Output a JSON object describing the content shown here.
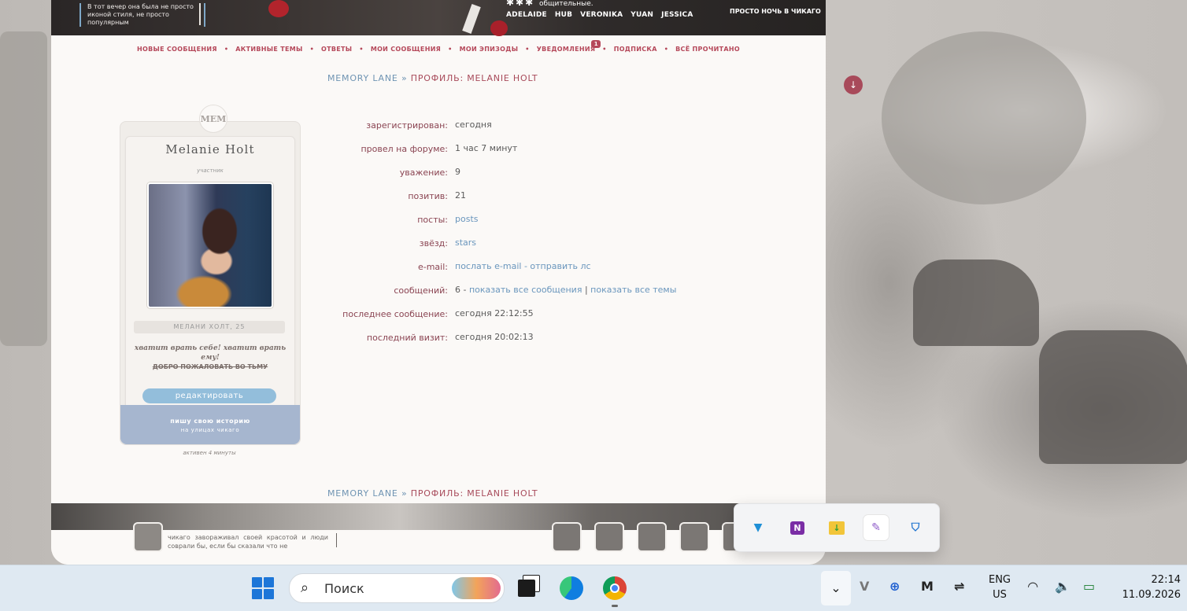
{
  "banner": {
    "quote": "В тот вечер она была не просто иконой стиля, не просто популярным",
    "partial_line": "общительные.",
    "names": [
      "ADELAIDE",
      "HUB",
      "VERONIKA",
      "YUAN",
      "JESSICA"
    ],
    "tagline": "ПРОСТО НОЧЬ В ЧИКАГО"
  },
  "nav": {
    "items": [
      "НОВЫЕ СООБЩЕНИЯ",
      "АКТИВНЫЕ ТЕМЫ",
      "ОТВЕТЫ",
      "МОИ СООБЩЕНИЯ",
      "МОИ ЭПИЗОДЫ",
      "УВЕДОМЛЕНИЯ",
      "ПОДПИСКА",
      "ВСЁ ПРОЧИТАНО"
    ],
    "dot": "•",
    "notifications_count": "1"
  },
  "breadcrumb": {
    "home": "MEMORY LANE",
    "separator": "»",
    "current": "ПРОФИЛЬ: MELANIE HOLT"
  },
  "card": {
    "logo": "MEM",
    "name": "Melanie Holt",
    "rank": "участник",
    "fullname": "МЕЛАНИ ХОЛТ, 25",
    "quote1": "хватит врать себе! хватит врать ему!",
    "quote2": "ДОБРО ПОЖАЛОВАТЬ ВО ТЬМУ",
    "edit_label": "редактировать",
    "bottom_line1": "пишу свою историю",
    "bottom_line2": "на улицах чикаго",
    "active": "активен 4 минуты"
  },
  "info": [
    {
      "label": "зарегистрирован:",
      "value": "сегодня"
    },
    {
      "label": "провел на форуме:",
      "value": "1 час 7 минут"
    },
    {
      "label": "уважение:",
      "value": "9"
    },
    {
      "label": "позитив:",
      "value": "21"
    },
    {
      "label": "посты:",
      "value": "posts"
    },
    {
      "label": "звёзд:",
      "value": "stars"
    },
    {
      "label": "e-mail:",
      "value": ""
    },
    {
      "label": "сообщений:",
      "value": ""
    },
    {
      "label": "последнее сообщение:",
      "value": "сегодня 22:12:55"
    },
    {
      "label": "последний визит:",
      "value": "сегодня 20:02:13"
    }
  ],
  "email_links": {
    "send_email": "послать e-mail",
    "dash": "-",
    "send_pm": "отправить лс"
  },
  "messages_links": {
    "count": "6",
    "dash": "-",
    "show_posts": "показать все сообщения",
    "pipe": "|",
    "show_topics": "показать все темы"
  },
  "footer": {
    "text": "чикаго завораживал своей красотой и люди соврали бы, если бы сказали что не"
  },
  "scroll_icon": "arrow-down-icon",
  "tray_popup": {
    "icons": [
      "shield-v-icon",
      "onenote-icon",
      "folder-download-icon",
      "feather-icon",
      "defender-warning-icon"
    ]
  },
  "taskbar": {
    "search_placeholder": "Поиск",
    "lang_line1": "ENG",
    "lang_line2": "US",
    "time": "22:14",
    "date": "11.09.2026"
  },
  "colors": {
    "accent": "#b5485a",
    "link": "#6a96bd",
    "button": "#93bedb",
    "card_bottom": "#a6b6cf"
  }
}
